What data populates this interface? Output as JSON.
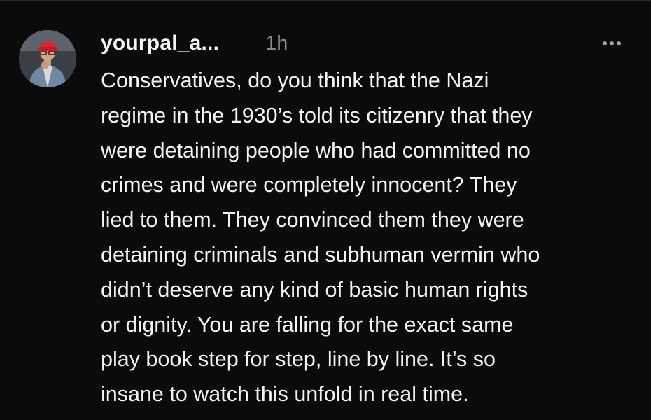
{
  "post": {
    "username": "yourpal_a...",
    "timestamp": "1h",
    "more_icon": "ellipsis-icon",
    "avatar_icon": "profile-photo",
    "body_lines": [
      "Conservatives, do you think that the Nazi",
      "regime in the 1930’s told its citizenry that they",
      "were detaining people who had committed no",
      "crimes and were completely innocent? They",
      "lied to them. They convinced them they were",
      "detaining criminals and subhuman vermin who",
      "didn’t deserve any kind of basic human rights",
      "or dignity. You are falling for the exact same",
      "play book step for step, line by line. It’s so",
      "insane to watch this unfold in real time."
    ]
  },
  "colors": {
    "background": "#0b0b0b",
    "text": "#f3f3f3",
    "muted": "#8a8a8a",
    "avatar_hat": "#e0242f"
  }
}
